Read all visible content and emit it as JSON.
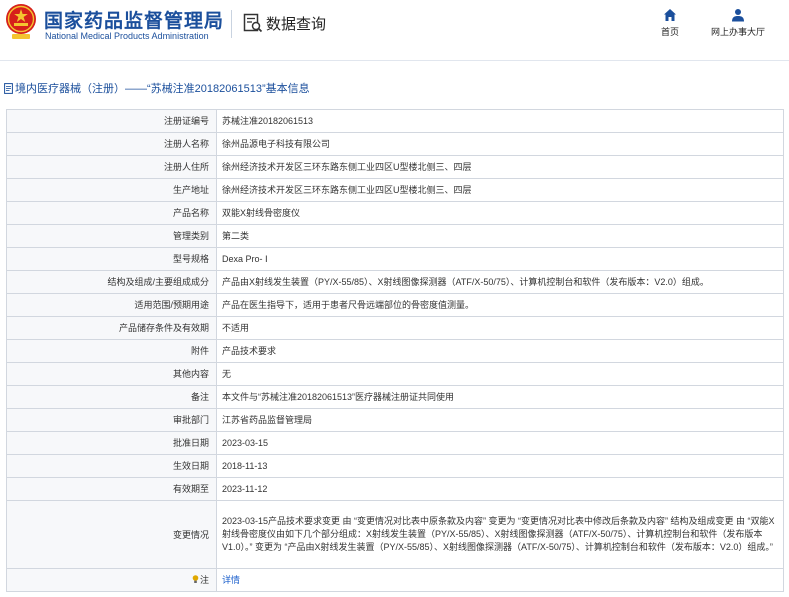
{
  "header": {
    "title_cn": "国家药品监督管理局",
    "title_en": "National Medical Products Administration",
    "query_label": "数据查询",
    "nav": {
      "home_label": "首页",
      "online_label": "网上办事大厅"
    }
  },
  "breadcrumb": {
    "text": "境内医疗器械（注册）——“苏械注准20182061513”基本信息"
  },
  "colors": {
    "brand_blue": "#1b4f9c",
    "link_blue": "#1b5fcc",
    "border": "#d2d7df"
  },
  "icons": [
    "emblem-icon",
    "query-icon",
    "home-icon",
    "user-icon",
    "document-icon",
    "lightbulb-icon"
  ],
  "rows": [
    {
      "label": "注册证编号",
      "value": "苏械注准20182061513"
    },
    {
      "label": "注册人名称",
      "value": "徐州品源电子科技有限公司"
    },
    {
      "label": "注册人住所",
      "value": "徐州经济技术开发区三环东路东侧工业四区U型楼北侧三、四层"
    },
    {
      "label": "生产地址",
      "value": "徐州经济技术开发区三环东路东侧工业四区U型楼北侧三、四层"
    },
    {
      "label": "产品名称",
      "value": "双能X射线骨密度仪"
    },
    {
      "label": "管理类别",
      "value": "第二类"
    },
    {
      "label": "型号规格",
      "value": "Dexa Pro- Ⅰ"
    },
    {
      "label": "结构及组成/主要组成成分",
      "value": "产品由X射线发生装置（PY/X-55/85）、X射线图像探测器（ATF/X-50/75）、计算机控制台和软件（发布版本：V2.0）组成。"
    },
    {
      "label": "适用范围/预期用途",
      "value": "产品在医生指导下，适用于患者尺骨远端部位的骨密度值测量。"
    },
    {
      "label": "产品储存条件及有效期",
      "value": "不适用"
    },
    {
      "label": "附件",
      "value": "产品技术要求"
    },
    {
      "label": "其他内容",
      "value": "无"
    },
    {
      "label": "备注",
      "value": "本文件与“苏械注准20182061513”医疗器械注册证共同使用"
    },
    {
      "label": "审批部门",
      "value": "江苏省药品监督管理局"
    },
    {
      "label": "批准日期",
      "value": "2023-03-15"
    },
    {
      "label": "生效日期",
      "value": "2018-11-13"
    },
    {
      "label": "有效期至",
      "value": "2023-11-12"
    },
    {
      "label": "变更情况",
      "value": "2023-03-15产品技术要求变更 由 “变更情况对比表中原条款及内容” 变更为 “变更情况对比表中修改后条款及内容” 结构及组成变更 由 “双能X射线骨密度仪由如下几个部分组成：X射线发生装置（PY/X-55/85）、X射线图像探测器（ATF/X-50/75）、计算机控制台和软件（发布版本V1.0）。” 变更为 “产品由X射线发生装置（PY/X-55/85）、X射线图像探测器（ATF/X-50/75）、计算机控制台和软件（发布版本：V2.0）组成。”"
    }
  ],
  "note_row": {
    "label": "注",
    "link": "详情"
  }
}
